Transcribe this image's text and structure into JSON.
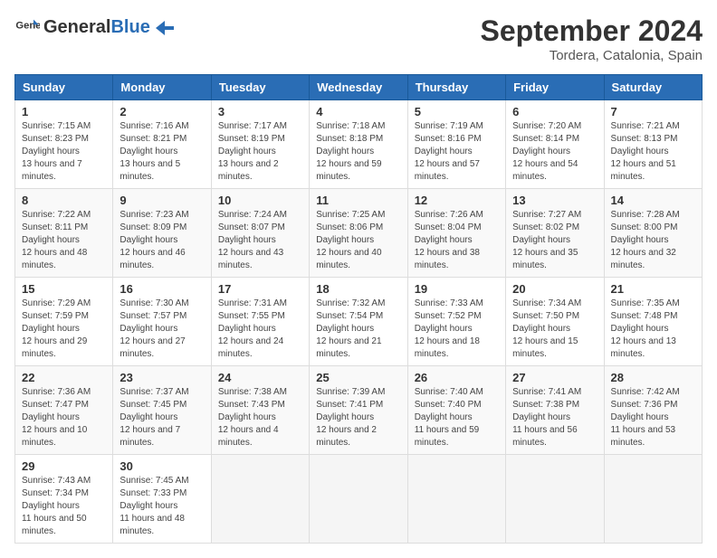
{
  "header": {
    "logo": {
      "text_general": "General",
      "text_blue": "Blue"
    },
    "title": "September 2024",
    "location": "Tordera, Catalonia, Spain"
  },
  "columns": [
    "Sunday",
    "Monday",
    "Tuesday",
    "Wednesday",
    "Thursday",
    "Friday",
    "Saturday"
  ],
  "weeks": [
    [
      {
        "day": "1",
        "sunrise": "7:15 AM",
        "sunset": "8:23 PM",
        "daylight": "13 hours and 7 minutes."
      },
      {
        "day": "2",
        "sunrise": "7:16 AM",
        "sunset": "8:21 PM",
        "daylight": "13 hours and 5 minutes."
      },
      {
        "day": "3",
        "sunrise": "7:17 AM",
        "sunset": "8:19 PM",
        "daylight": "13 hours and 2 minutes."
      },
      {
        "day": "4",
        "sunrise": "7:18 AM",
        "sunset": "8:18 PM",
        "daylight": "12 hours and 59 minutes."
      },
      {
        "day": "5",
        "sunrise": "7:19 AM",
        "sunset": "8:16 PM",
        "daylight": "12 hours and 57 minutes."
      },
      {
        "day": "6",
        "sunrise": "7:20 AM",
        "sunset": "8:14 PM",
        "daylight": "12 hours and 54 minutes."
      },
      {
        "day": "7",
        "sunrise": "7:21 AM",
        "sunset": "8:13 PM",
        "daylight": "12 hours and 51 minutes."
      }
    ],
    [
      {
        "day": "8",
        "sunrise": "7:22 AM",
        "sunset": "8:11 PM",
        "daylight": "12 hours and 48 minutes."
      },
      {
        "day": "9",
        "sunrise": "7:23 AM",
        "sunset": "8:09 PM",
        "daylight": "12 hours and 46 minutes."
      },
      {
        "day": "10",
        "sunrise": "7:24 AM",
        "sunset": "8:07 PM",
        "daylight": "12 hours and 43 minutes."
      },
      {
        "day": "11",
        "sunrise": "7:25 AM",
        "sunset": "8:06 PM",
        "daylight": "12 hours and 40 minutes."
      },
      {
        "day": "12",
        "sunrise": "7:26 AM",
        "sunset": "8:04 PM",
        "daylight": "12 hours and 38 minutes."
      },
      {
        "day": "13",
        "sunrise": "7:27 AM",
        "sunset": "8:02 PM",
        "daylight": "12 hours and 35 minutes."
      },
      {
        "day": "14",
        "sunrise": "7:28 AM",
        "sunset": "8:00 PM",
        "daylight": "12 hours and 32 minutes."
      }
    ],
    [
      {
        "day": "15",
        "sunrise": "7:29 AM",
        "sunset": "7:59 PM",
        "daylight": "12 hours and 29 minutes."
      },
      {
        "day": "16",
        "sunrise": "7:30 AM",
        "sunset": "7:57 PM",
        "daylight": "12 hours and 27 minutes."
      },
      {
        "day": "17",
        "sunrise": "7:31 AM",
        "sunset": "7:55 PM",
        "daylight": "12 hours and 24 minutes."
      },
      {
        "day": "18",
        "sunrise": "7:32 AM",
        "sunset": "7:54 PM",
        "daylight": "12 hours and 21 minutes."
      },
      {
        "day": "19",
        "sunrise": "7:33 AM",
        "sunset": "7:52 PM",
        "daylight": "12 hours and 18 minutes."
      },
      {
        "day": "20",
        "sunrise": "7:34 AM",
        "sunset": "7:50 PM",
        "daylight": "12 hours and 15 minutes."
      },
      {
        "day": "21",
        "sunrise": "7:35 AM",
        "sunset": "7:48 PM",
        "daylight": "12 hours and 13 minutes."
      }
    ],
    [
      {
        "day": "22",
        "sunrise": "7:36 AM",
        "sunset": "7:47 PM",
        "daylight": "12 hours and 10 minutes."
      },
      {
        "day": "23",
        "sunrise": "7:37 AM",
        "sunset": "7:45 PM",
        "daylight": "12 hours and 7 minutes."
      },
      {
        "day": "24",
        "sunrise": "7:38 AM",
        "sunset": "7:43 PM",
        "daylight": "12 hours and 4 minutes."
      },
      {
        "day": "25",
        "sunrise": "7:39 AM",
        "sunset": "7:41 PM",
        "daylight": "12 hours and 2 minutes."
      },
      {
        "day": "26",
        "sunrise": "7:40 AM",
        "sunset": "7:40 PM",
        "daylight": "11 hours and 59 minutes."
      },
      {
        "day": "27",
        "sunrise": "7:41 AM",
        "sunset": "7:38 PM",
        "daylight": "11 hours and 56 minutes."
      },
      {
        "day": "28",
        "sunrise": "7:42 AM",
        "sunset": "7:36 PM",
        "daylight": "11 hours and 53 minutes."
      }
    ],
    [
      {
        "day": "29",
        "sunrise": "7:43 AM",
        "sunset": "7:34 PM",
        "daylight": "11 hours and 50 minutes."
      },
      {
        "day": "30",
        "sunrise": "7:45 AM",
        "sunset": "7:33 PM",
        "daylight": "11 hours and 48 minutes."
      },
      null,
      null,
      null,
      null,
      null
    ]
  ],
  "labels": {
    "sunrise": "Sunrise:",
    "sunset": "Sunset:",
    "daylight": "Daylight hours"
  }
}
